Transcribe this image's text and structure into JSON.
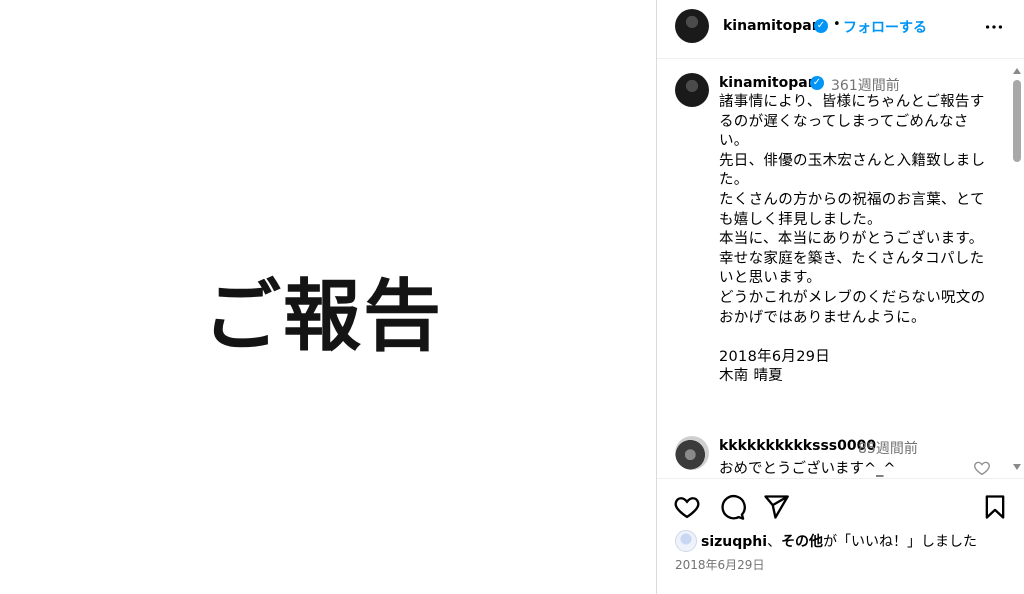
{
  "image_panel": {
    "text": "ご報告"
  },
  "header": {
    "username": "kinamitopan",
    "follow_label": "フォローする",
    "separator": "•"
  },
  "caption": {
    "username": "kinamitopan",
    "time": "361週間前",
    "paragraphs": [
      "諸事情により、皆様にちゃんとご報告するのが遅くなってしまってごめんなさい。",
      "先日、俳優の玉木宏さんと入籍致しました。",
      "たくさんの方からの祝福のお言葉、とても嬉しく拝見しました。",
      "本当に、本当にありがとうございます。",
      "幸せな家庭を築き、たくさんタコパしたいと思います。",
      "どうかこれがメレブのくだらない呪文のおかげではありませんように。",
      "",
      "2018年6月29日",
      "木南 晴夏"
    ]
  },
  "comments": [
    {
      "username": "kkkkkkkkkksss0000",
      "time": "85週間前",
      "text": "おめでとうございます^_^"
    }
  ],
  "likes": {
    "first_user": "sizuqphi",
    "connector": "、",
    "others": "その他",
    "suffix": "が「いいね！」しました"
  },
  "post_date": "2018年6月29日",
  "icons": {
    "verified": "verified-badge-icon",
    "more": "more-options-icon",
    "like": "heart-icon",
    "comment": "comment-bubble-icon",
    "share": "paper-plane-icon",
    "save": "bookmark-icon"
  },
  "colors": {
    "link": "#0095f6",
    "muted": "#737373",
    "verified": "#0095f6"
  }
}
